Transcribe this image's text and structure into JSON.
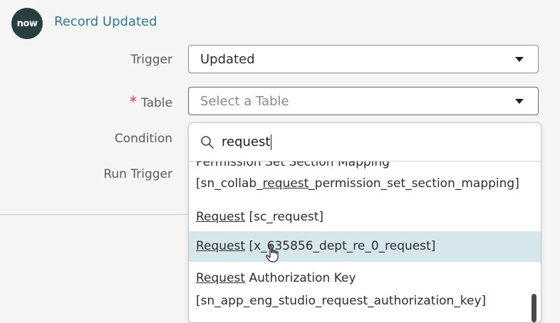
{
  "header": {
    "logo_text": "now",
    "title": "Record Updated"
  },
  "form": {
    "trigger_label": "Trigger",
    "trigger_value": "Updated",
    "table_required_mark": "*",
    "table_label": "Table",
    "table_placeholder": "Select a Table",
    "condition_label": "Condition",
    "run_trigger_label": "Run Trigger"
  },
  "dropdown": {
    "search_value": "request",
    "options": [
      {
        "line1": "Permission Set Section Mapping",
        "line2_pre": "[sn_collab_",
        "line2_match": "request",
        "line2_post": "_permission_set_section_mapping]"
      },
      {
        "match": "Request",
        "rest": " [sc_request]"
      },
      {
        "match": "Request",
        "rest": " [x_635856_dept_re_0_request]"
      },
      {
        "match": "Request",
        "rest": " Authorization Key",
        "line2": "[sn_app_eng_studio_request_authorization_key]"
      }
    ]
  },
  "icons": [
    "now-logo",
    "chevron-down-icon",
    "search-icon",
    "hand-cursor-icon"
  ],
  "colors": {
    "accent": "#2c7a8c",
    "highlight": "#d5e6ec",
    "required": "#c83c3c"
  }
}
